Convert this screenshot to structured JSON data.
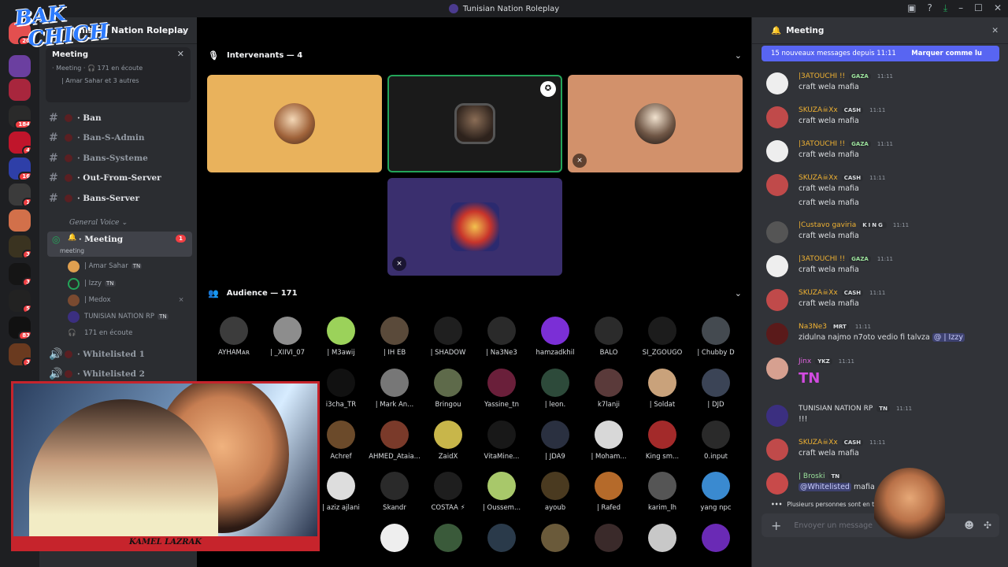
{
  "window": {
    "title": "Tunisian Nation Roleplay"
  },
  "overlay": {
    "logo_line1": "BAK",
    "logo_line2": "CHICH",
    "cam_caption": "KAMEL LAZRAK"
  },
  "guilds": [
    {
      "badge": "20"
    },
    {
      "badge": ""
    },
    {
      "badge": "184"
    },
    {
      "badge": "4"
    },
    {
      "badge": "16"
    },
    {
      "badge": "1"
    },
    {
      "badge": ""
    },
    {
      "badge": "3"
    },
    {
      "badge": "3"
    },
    {
      "badge": "5"
    },
    {
      "badge": "83"
    },
    {
      "badge": "3"
    }
  ],
  "sidebar": {
    "server_name": "Tunisian Nation Roleplay",
    "voice_panel": {
      "channel": "Meeting",
      "sub": "· Meeting · 🎧 171 en écoute",
      "users": "| Amar Sahar et 3 autres"
    },
    "channels": [
      {
        "name": "· Ban"
      },
      {
        "name": "· Ban-S-Admin"
      },
      {
        "name": "· Bans-Systeme"
      },
      {
        "name": "· Out-From-Server"
      },
      {
        "name": "· Bans-Server"
      }
    ],
    "category": "General Voice",
    "meeting": {
      "name": "· Meeting",
      "badge": "1",
      "sub": "meeting"
    },
    "voice_users": [
      {
        "name": "| Amar Sahar",
        "tag": "TN"
      },
      {
        "name": "| Izzy",
        "tag": "TN"
      },
      {
        "name": "| Medox",
        "tag": ""
      },
      {
        "name": "TUNISIAN NATION RP",
        "tag": "TN"
      },
      {
        "name": "171 en écoute",
        "tag": ""
      }
    ],
    "voice_channels": [
      {
        "name": "· Whitelisted 1"
      },
      {
        "name": "· Whitelisted 2"
      }
    ]
  },
  "stage": {
    "speakers_label": "Intervenants — 4",
    "audience_label": "Audience — 171",
    "audience": [
      "AYHAMᴀʀ",
      "| _XIIVI_07",
      "| M3awij",
      "| IH EB",
      "| SHADOW",
      "| Na3Ne3",
      "hamzadkhil",
      "BALO",
      "SI_ZGOUGO",
      "| Chubby D",
      "i3cha_TR",
      "| Mark An...",
      "Bringou",
      "Yassine_tn",
      "| leon.",
      "k7lanji",
      "| Soldat",
      "| DJD",
      "",
      "Achref",
      "AHMED_Ataia...",
      "ZaidX",
      "VitaMine...",
      "| JDA9",
      "| Moham...",
      "King sm...",
      "0.input",
      "",
      "| aziz ajlani",
      "Skandr",
      "COSTAA ⚡",
      "| Oussem...",
      "ayoub",
      "| Rafed",
      "karim_lh",
      "yang npc"
    ]
  },
  "chat": {
    "title": "Meeting",
    "banner_text": "15 nouveaux messages depuis 11:11",
    "banner_action": "Marquer comme lu",
    "messages": [
      {
        "name": "|3ATOUCHI !!",
        "role": "GAZA",
        "time": "11:11",
        "text": "craft  wela mafia",
        "text2": ""
      },
      {
        "name": "SKUZA☠Xx",
        "role": "CASH",
        "time": "11:11",
        "text": "craft  wela mafia",
        "text2": ""
      },
      {
        "name": "|3ATOUCHI !!",
        "role": "GAZA",
        "time": "11:11",
        "text": "craft  wela mafia",
        "text2": ""
      },
      {
        "name": "SKUZA☠Xx",
        "role": "CASH",
        "time": "11:11",
        "text": "craft  wela mafia",
        "text2": "craft  wela mafia"
      },
      {
        "name": "|Custavo gaviria",
        "role": "KING",
        "time": "11:11",
        "text": "craft  wela mafia",
        "text2": ""
      },
      {
        "name": "|3ATOUCHI !!",
        "role": "GAZA",
        "time": "11:11",
        "text": "craft  wela mafia",
        "text2": ""
      },
      {
        "name": "SKUZA☠Xx",
        "role": "CASH",
        "time": "11:11",
        "text": "craft  wela mafia",
        "text2": ""
      },
      {
        "name": "Na3Ne3",
        "role": "MRT",
        "time": "11:11",
        "text": "zidulna najmo n7oto vedio fi talvza",
        "mention": "@ | Izzy",
        "text2": ""
      },
      {
        "name": "Jinx",
        "role": "YKZ",
        "time": "11:11",
        "text": "TN",
        "text2": ""
      },
      {
        "name": "TUNISIAN NATION RP",
        "role": "TN",
        "time": "11:11",
        "text": "!!!",
        "text2": ""
      },
      {
        "name": "SKUZA☠Xx",
        "role": "CASH",
        "time": "11:11",
        "text": "craft  wela mafia",
        "text2": ""
      },
      {
        "name": "| Broski",
        "role": "TN",
        "time": "",
        "text": "mafia",
        "mention": "@Whitelisted",
        "text2": ""
      }
    ],
    "typing": "Plusieurs personnes sont en train d'écrire...",
    "placeholder": "Envoyer un message"
  },
  "colors": {
    "accent": "#5865f2",
    "online": "#23a559",
    "danger": "#f23f43"
  }
}
